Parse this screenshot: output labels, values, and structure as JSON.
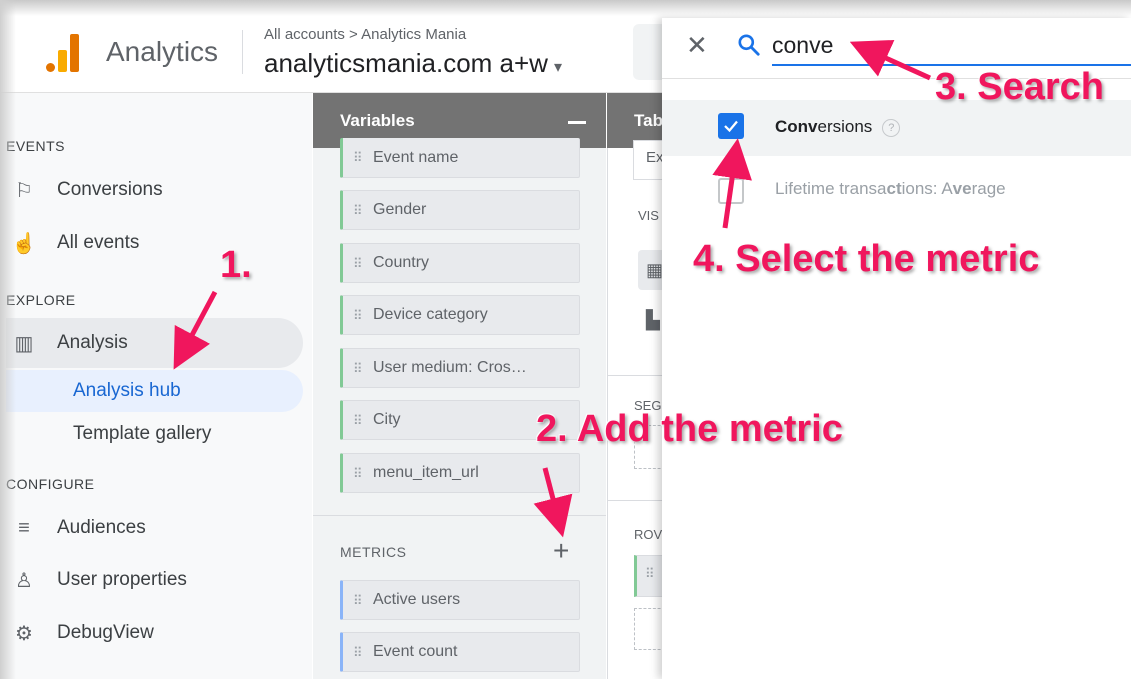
{
  "header": {
    "app_name": "Analytics",
    "breadcrumb": "All accounts > Analytics Mania",
    "property": "analyticsmania.com a+w",
    "property_caret": "▾"
  },
  "nav": {
    "sections": {
      "events": "EVENTS",
      "explore": "EXPLORE",
      "configure": "CONFIGURE"
    },
    "items": [
      {
        "label": "Conversions",
        "icon": "flag-icon"
      },
      {
        "label": "All events",
        "icon": "touch-icon"
      },
      {
        "label": "Analysis",
        "icon": "analysis-icon"
      },
      {
        "label": "Audiences",
        "icon": "audiences-icon"
      },
      {
        "label": "User properties",
        "icon": "user-properties-icon"
      },
      {
        "label": "DebugView",
        "icon": "debug-icon"
      }
    ],
    "sub_items": [
      {
        "label": "Analysis hub",
        "active": true
      },
      {
        "label": "Template gallery",
        "active": false
      }
    ]
  },
  "variables": {
    "title": "Variables",
    "dimensions": [
      "Event name",
      "Gender",
      "Country",
      "Device category",
      "User medium: Cros…",
      "City",
      "menu_item_url"
    ],
    "metrics_label": "METRICS",
    "metrics_add": "+",
    "metrics": [
      "Active users",
      "Event count"
    ]
  },
  "tab_settings": {
    "title": "Tab",
    "technique_value": "Ex",
    "visualization_label": "VIS",
    "segments_label": "SEG",
    "rows_label": "ROV"
  },
  "search_panel": {
    "query": "conve",
    "close_symbol": "✕",
    "results": [
      {
        "match": "Conv",
        "rest": "ersions",
        "checked": true,
        "help": "?"
      },
      {
        "pre": "Lifetime transa",
        "m1": "ct",
        "mid": "ions: A",
        "m2": "ve",
        "post": "rage",
        "checked": false
      }
    ]
  },
  "annotations": {
    "step1": "1.",
    "step2": "2. Add the metric",
    "step3": "3. Search",
    "step4": "4. Select the metric",
    "color": "#f0165d"
  },
  "colors": {
    "accent_blue": "#1a73e8",
    "header_gray": "#737373",
    "dimension_green": "#81c995",
    "metric_blue": "#8ab4f8"
  }
}
